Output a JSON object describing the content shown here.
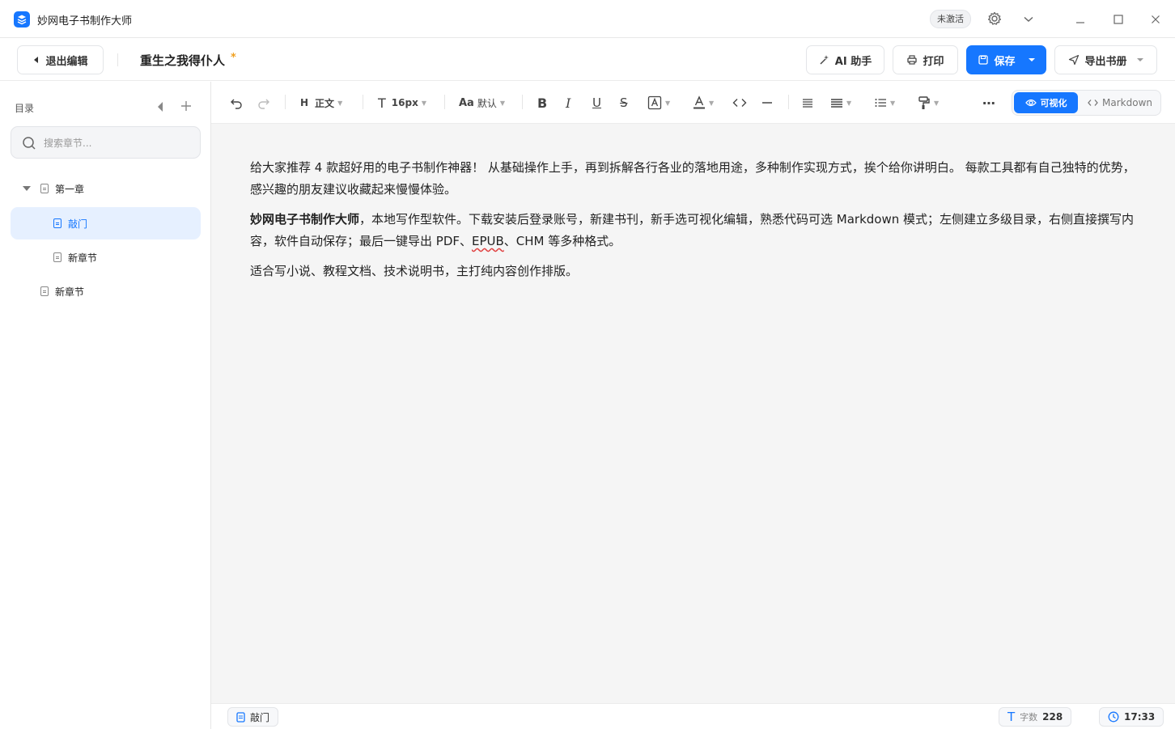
{
  "app": {
    "title": "妙网电子书制作大师",
    "badge": "未激活"
  },
  "header": {
    "back_label": "退出编辑",
    "doc_title": "重生之我得仆人",
    "unsaved_mark": "*",
    "ai_label": "AI 助手",
    "print_label": "打印",
    "save_label": "保存",
    "export_label": "导出书册"
  },
  "sidebar": {
    "heading": "目录",
    "search_placeholder": "搜索章节...",
    "items": [
      {
        "label": "第一章",
        "level": 0,
        "expanded": true
      },
      {
        "label": "敲门",
        "level": 1,
        "active": true
      },
      {
        "label": "新章节",
        "level": 1
      },
      {
        "label": "新章节",
        "level": 0
      }
    ]
  },
  "toolbar": {
    "heading_label": "正文",
    "size_label": "16px",
    "font_label": "默认",
    "mode_visual": "可视化",
    "mode_markdown": "Markdown"
  },
  "content": {
    "p1": "给大家推荐 4 款超好用的电子书制作神器！ 从基础操作上手，再到拆解各行各业的落地用途，多种制作实现方式，挨个给你讲明白。 每款工具都有自己独特的优势，感兴趣的朋友建议收藏起来慢慢体验。",
    "p2_bold": "妙网电子书制作大师",
    "p2_a": "，本地写作型软件。下载安装后登录账号，新建书刊，新手选可视化编辑，熟悉代码可选 Markdown 模式；左侧建立多级目录，右侧直接撰写内容，软件自动保存；最后一键导出 PDF、",
    "p2_epub": "EPUB",
    "p2_b": "、CHM 等多种格式。",
    "p3": "适合写小说、教程文档、技术说明书，主打纯内容创作排版。"
  },
  "status": {
    "chapter": "敲门",
    "word_label": "字数",
    "word_count": "228",
    "time": "17:33"
  },
  "colors": {
    "accent": "#1677ff",
    "star": "#f0a020"
  }
}
